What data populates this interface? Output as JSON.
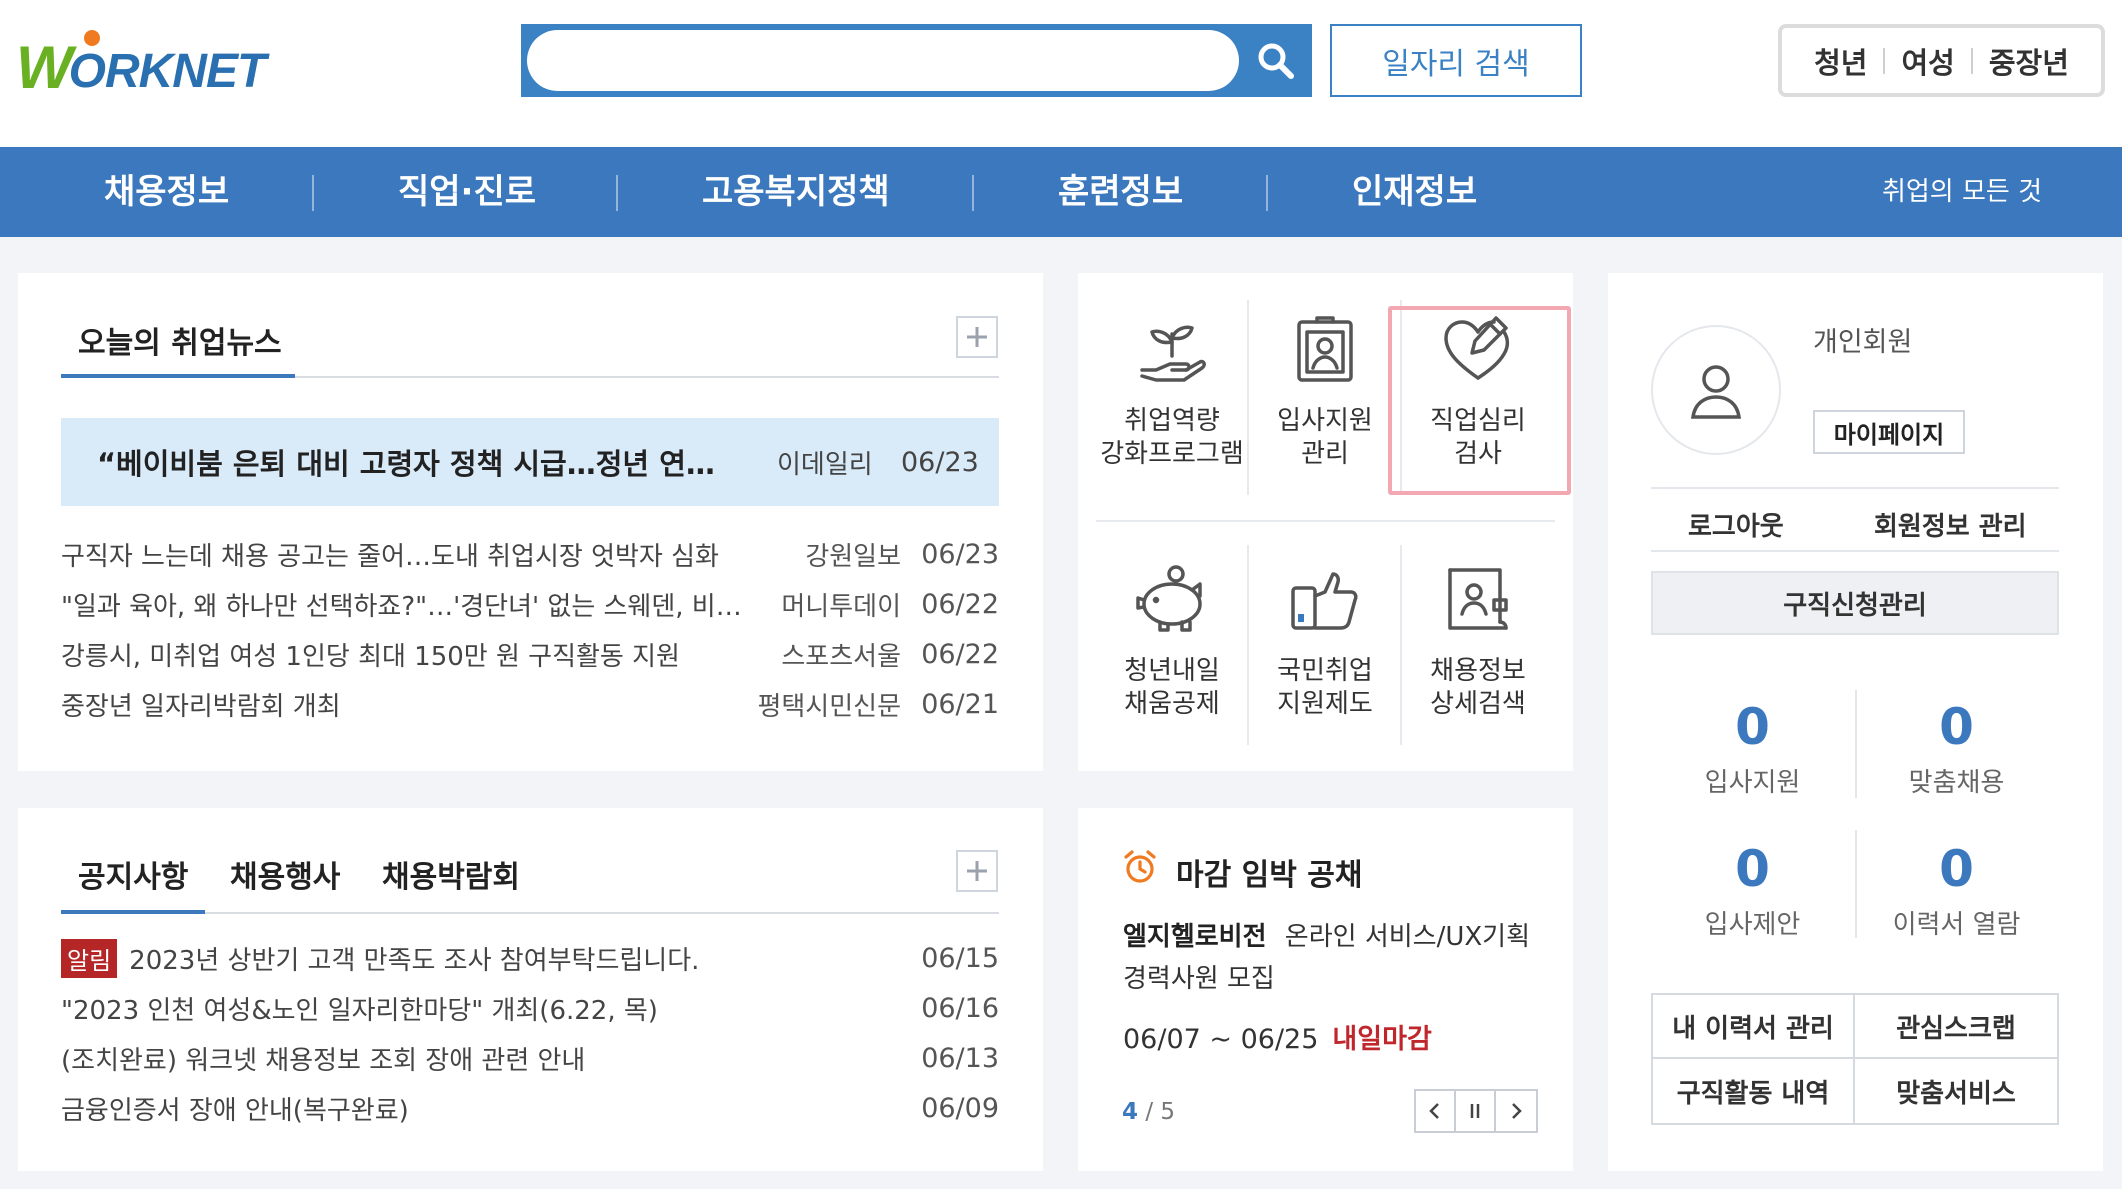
{
  "header": {
    "logo_text": "WORKNET",
    "search_placeholder": "",
    "job_search_label": "일자리 검색",
    "audience": [
      "청년",
      "여성",
      "중장년"
    ]
  },
  "nav": {
    "items": [
      "채용정보",
      "직업·진로",
      "고용복지정책",
      "훈련정보",
      "인재정보"
    ],
    "right": "취업의 모든 것"
  },
  "news": {
    "title": "오늘의 취업뉴스",
    "headline": {
      "title": "“베이비붐 은퇴 대비 고령자 정책 시급…정년 연장…",
      "source": "이데일리",
      "date": "06/23"
    },
    "items": [
      {
        "title": "구직자 느는데 채용 공고는 줄어…도내 취업시장 엇박자 심화",
        "source": "강원일보",
        "date": "06/23"
      },
      {
        "title": "\"일과 육아, 왜 하나만 선택하죠?\"…'경단녀' 없는 스웨덴, 비…",
        "source": "머니투데이",
        "date": "06/22"
      },
      {
        "title": "강릉시, 미취업 여성 1인당 최대 150만 원 구직활동 지원",
        "source": "스포츠서울",
        "date": "06/22"
      },
      {
        "title": "중장년 일자리박람회 개최",
        "source": "평택시민신문",
        "date": "06/21"
      }
    ]
  },
  "notices": {
    "tabs": [
      "공지사항",
      "채용행사",
      "채용박람회"
    ],
    "badge": "알림",
    "items": [
      {
        "title": "2023년 상반기 고객 만족도 조사 참여부탁드립니다.",
        "date": "06/15"
      },
      {
        "title": "\"2023 인천 여성&노인 일자리한마당\" 개최(6.22, 목)",
        "date": "06/16"
      },
      {
        "title": "(조치완료) 워크넷 채용정보 조회 장애 관련 안내",
        "date": "06/13"
      },
      {
        "title": "금융인증서 장애 안내(복구완료)",
        "date": "06/09"
      }
    ]
  },
  "services": [
    {
      "label1": "취업역량",
      "label2": "강화프로그램",
      "icon": "sprout-hand-icon"
    },
    {
      "label1": "입사지원",
      "label2": "관리",
      "icon": "id-card-icon"
    },
    {
      "label1": "직업심리",
      "label2": "검사",
      "icon": "heart-pen-icon"
    },
    {
      "label1": "청년내일",
      "label2": "채움공제",
      "icon": "piggy-bank-icon"
    },
    {
      "label1": "국민취업",
      "label2": "지원제도",
      "icon": "thumbs-up-phone-icon"
    },
    {
      "label1": "채용정보",
      "label2": "상세검색",
      "icon": "profile-scroll-icon"
    }
  ],
  "deadline": {
    "title": "마감 임박 공채",
    "company": "엘지헬로비전",
    "desc": "온라인 서비스/UX기획 경력사원 모집",
    "dates": "06/07 ~ 06/25",
    "urgent": "내일마감",
    "page_current": "4",
    "page_total": "/ 5"
  },
  "member": {
    "type": "개인회원",
    "mypage": "마이페이지",
    "logout": "로그아웃",
    "info": "회원정보 관리",
    "job_apply": "구직신청관리",
    "stats": [
      {
        "value": "0",
        "label": "입사지원"
      },
      {
        "value": "0",
        "label": "맞춤채용"
      },
      {
        "value": "0",
        "label": "입사제안"
      },
      {
        "value": "0",
        "label": "이력서 열람"
      }
    ],
    "links": [
      "내 이력서 관리",
      "관심스크랩",
      "구직활동 내역",
      "맞춤서비스"
    ]
  },
  "colors": {
    "brand_blue": "#3b78bd",
    "logo_green": "#6ab023",
    "urgent_red": "#c0272d",
    "headline_bg": "#d9eaf8"
  }
}
